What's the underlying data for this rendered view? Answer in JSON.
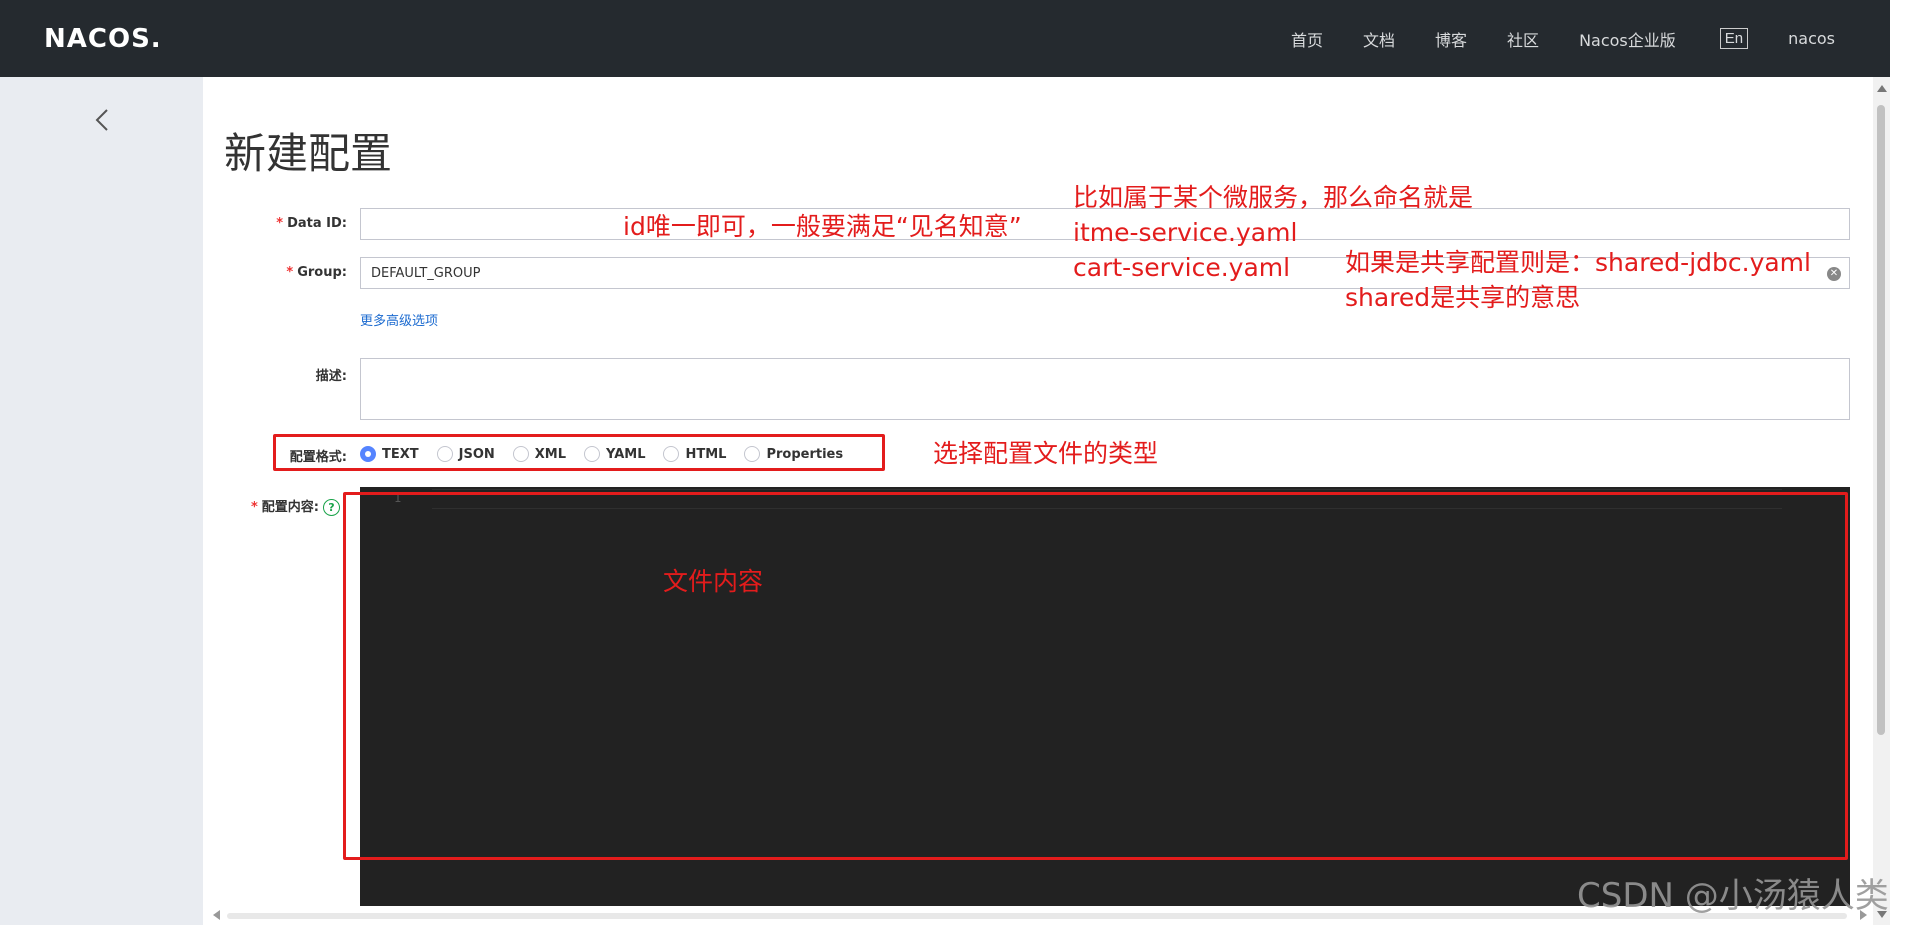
{
  "header": {
    "logo": "NACOS.",
    "nav": [
      "首页",
      "文档",
      "博客",
      "社区",
      "Nacos企业版"
    ],
    "lang_button": "En",
    "user": "nacos"
  },
  "page": {
    "title": "新建配置"
  },
  "form": {
    "data_id": {
      "label": "Data ID:",
      "value": ""
    },
    "group": {
      "label": "Group:",
      "value": "DEFAULT_GROUP"
    },
    "advanced_link": "更多高级选项",
    "description": {
      "label": "描述:",
      "value": ""
    },
    "format": {
      "label": "配置格式:",
      "options": [
        "TEXT",
        "JSON",
        "XML",
        "YAML",
        "HTML",
        "Properties"
      ],
      "selected": "TEXT"
    },
    "content": {
      "label": "配置内容:",
      "line_number": "1"
    }
  },
  "annotations": {
    "id_note": "id唯一即可，一般要满足“见名知意”",
    "naming_note": [
      "比如属于某个微服务，那么命名就是",
      "itme-service.yaml",
      "cart-service.yaml"
    ],
    "shared_note": [
      "如果是共享配置则是：shared-jdbc.yaml",
      "shared是共享的意思"
    ],
    "format_note": "选择配置文件的类型",
    "content_note": "文件内容"
  },
  "watermark": "CSDN @小汤猿人类",
  "colors": {
    "accent": "#5584ff",
    "annotation": "#e31c1c",
    "topbar": "#252a2f",
    "sidebar": "#e9ecf1",
    "editor": "#222222"
  }
}
